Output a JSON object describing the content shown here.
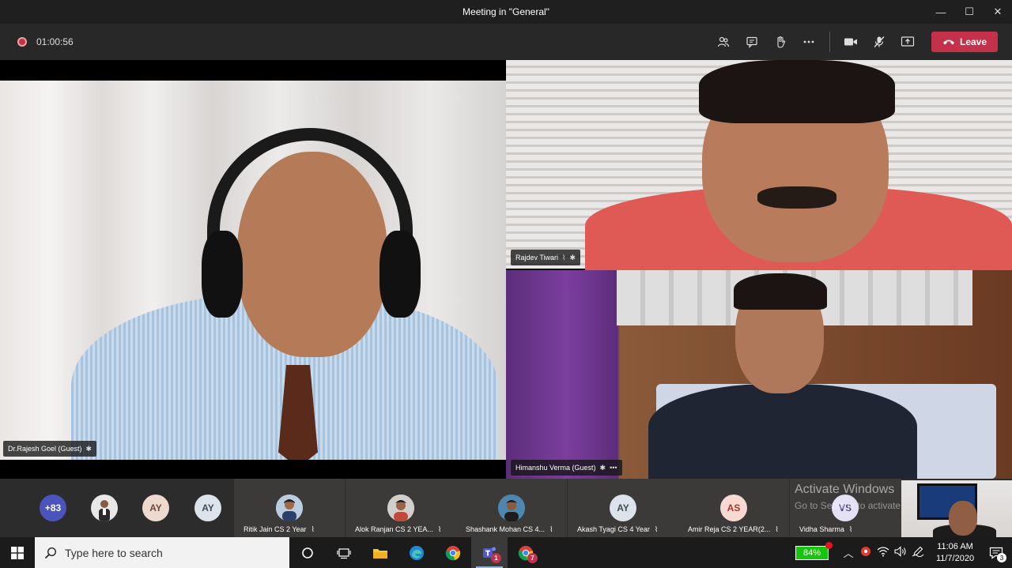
{
  "window": {
    "title": "Meeting in \"General\"",
    "minimize_glyph": "—",
    "maximize_glyph": "☐",
    "close_glyph": "✕"
  },
  "meeting": {
    "elapsed": "01:00:56",
    "leave_label": "Leave"
  },
  "toolbar_icons": [
    "participants-icon",
    "chat-icon",
    "raise-hand-icon",
    "more-icon",
    "camera-icon",
    "mic-off-icon",
    "share-screen-icon"
  ],
  "videos": {
    "main": {
      "name": "Dr.Rajesh Goel (Guest)"
    },
    "top_right": {
      "name": "Rajdev Tiwari"
    },
    "bottom_right": {
      "name": "Himanshu Verma (Guest)"
    }
  },
  "strip": {
    "overflow_count": "+83",
    "circle_1_initials": "AY",
    "circle_2_initials": "AY",
    "tiles": [
      {
        "name": "Ritik Jain CS 2 Year",
        "initials": ""
      },
      {
        "name": "Alok Ranjan CS 2 YEA...",
        "initials": ""
      },
      {
        "name": "Shashank Mohan CS 4...",
        "initials": ""
      },
      {
        "name": "Akash Tyagi CS 4 Year",
        "initials": "AY"
      },
      {
        "name": "Amir Reja CS 2 YEAR(2...",
        "initials": "AS"
      },
      {
        "name": "Vidha Sharma",
        "initials": "VS"
      }
    ],
    "activate_title": "Activate Windows",
    "activate_sub": "Go to Settings to activate Windows."
  },
  "taskbar": {
    "search_placeholder": "Type here to search",
    "teams_badge": "1",
    "chrome_badge": "7",
    "battery": "84%",
    "time": "11:06 AM",
    "date": "11/7/2020",
    "notifications": "3"
  },
  "colors": {
    "leave": "#c4314b",
    "battery": "#16c60c"
  }
}
